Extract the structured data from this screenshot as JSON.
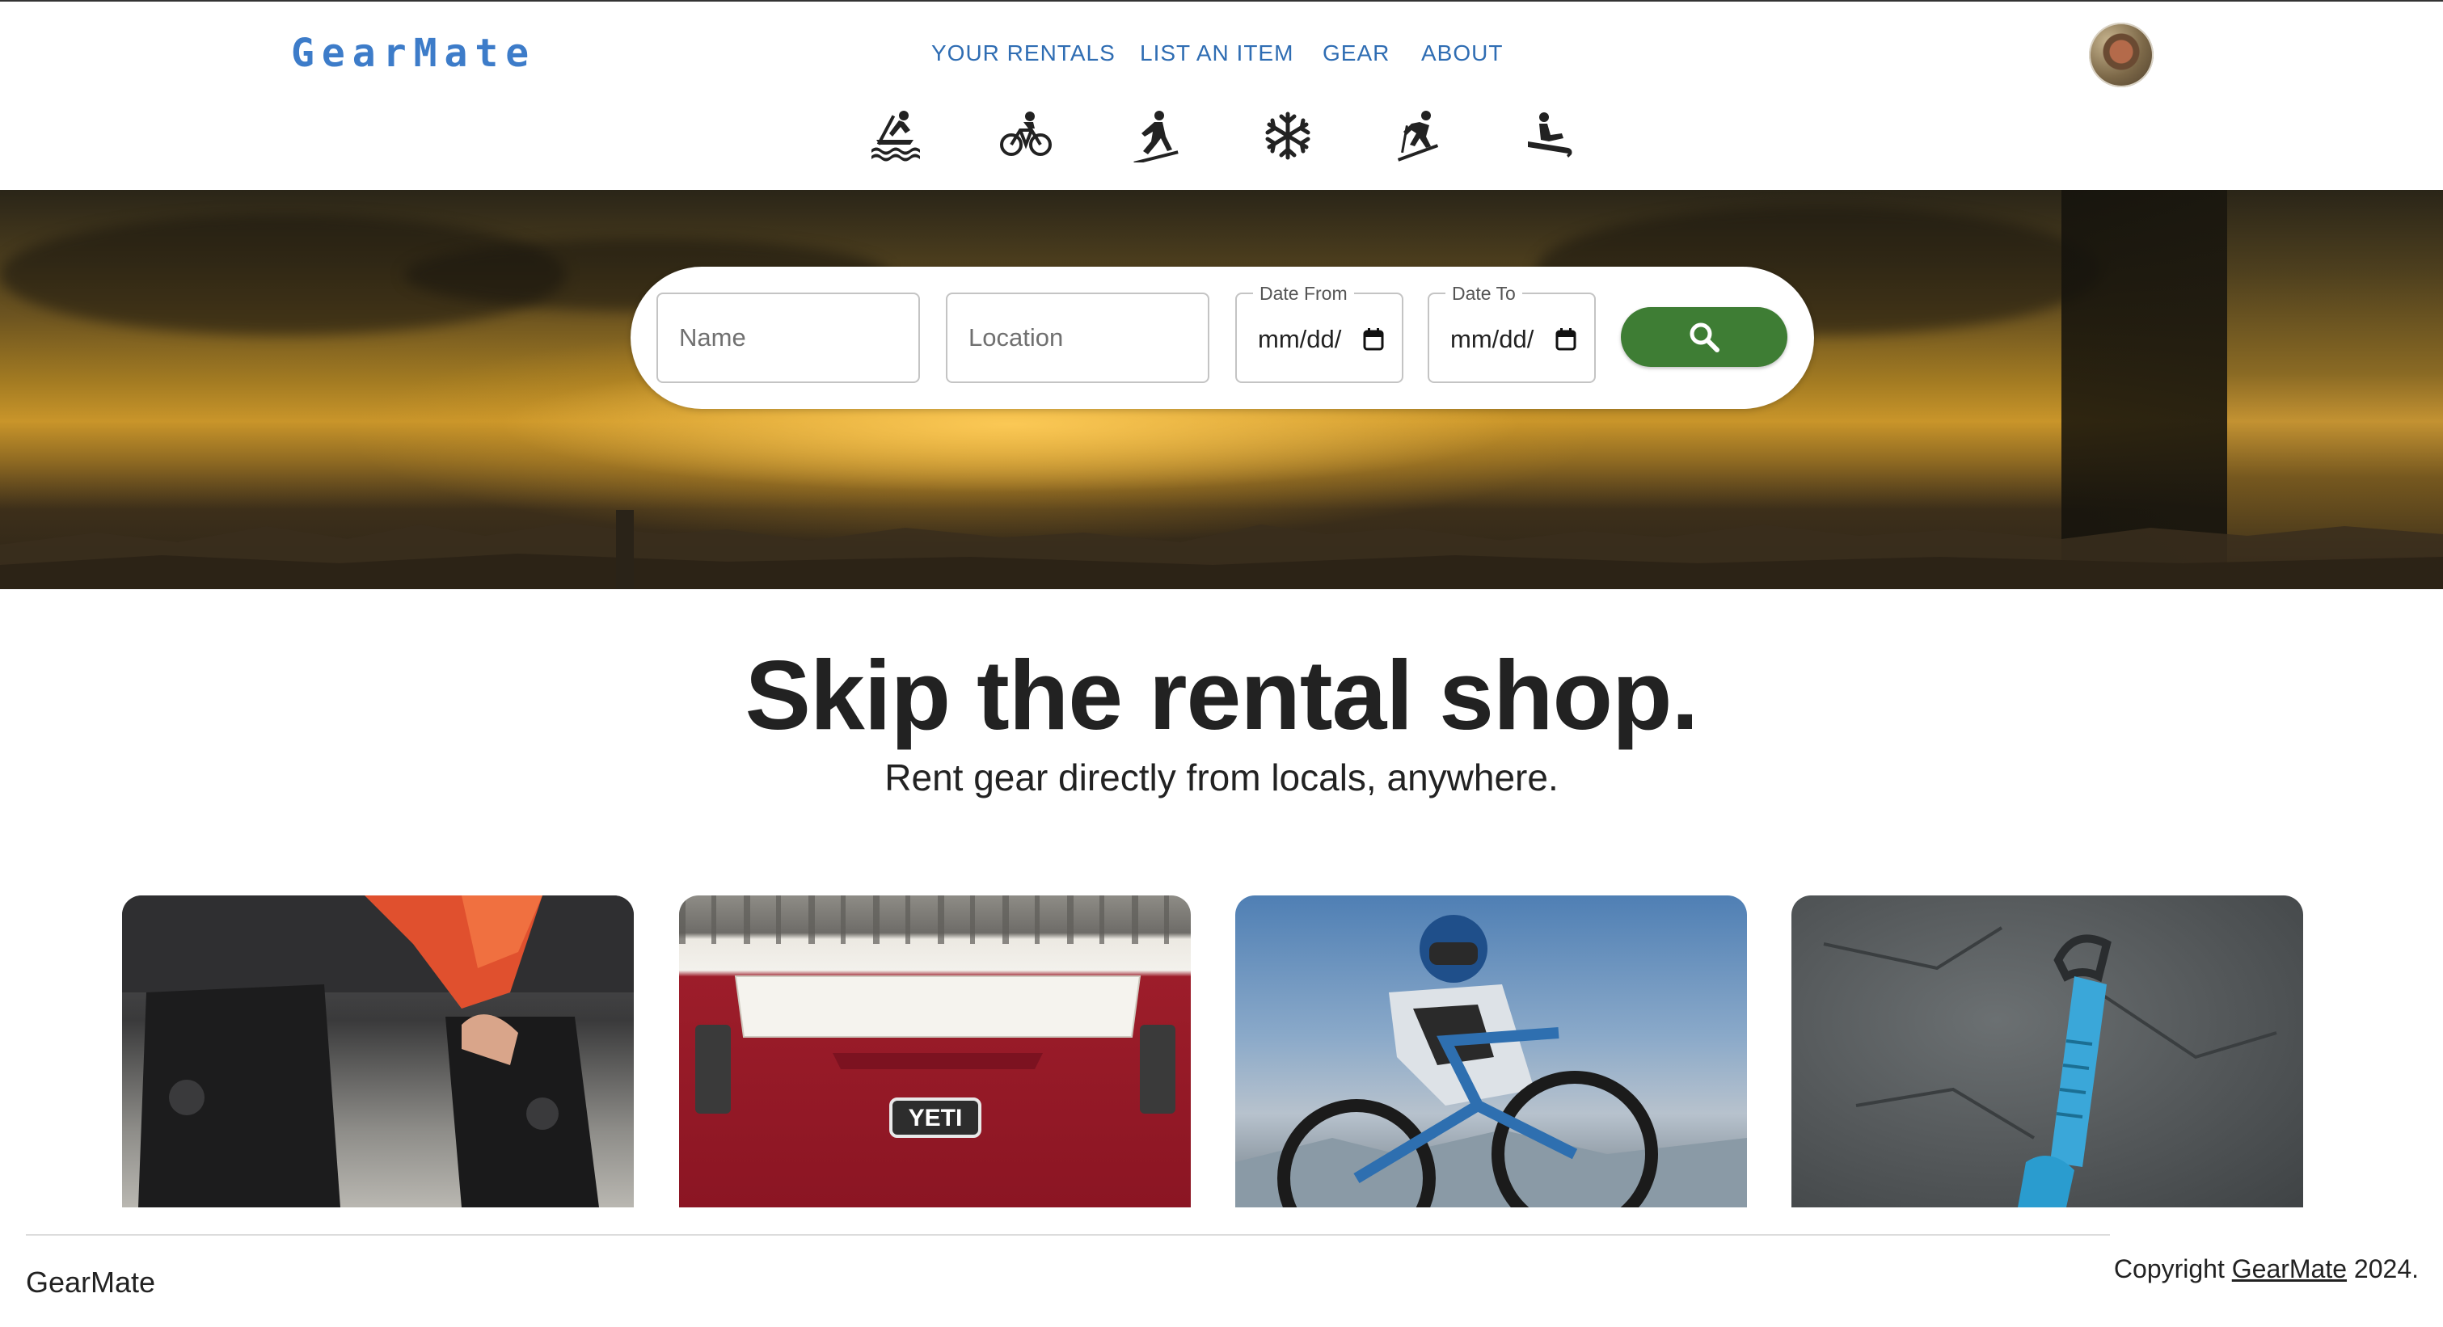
{
  "header": {
    "logo": "GearMate",
    "nav": [
      {
        "label": "YOUR RENTALS"
      },
      {
        "label": "LIST AN ITEM"
      },
      {
        "label": "GEAR"
      },
      {
        "label": "ABOUT"
      }
    ],
    "avatar_icon": "user-avatar",
    "sport_icons": [
      "kayaking-icon",
      "cycling-icon",
      "hiking-icon",
      "snow-icon",
      "skiing-icon",
      "sledding-icon"
    ]
  },
  "search": {
    "name_placeholder": "Name",
    "location_placeholder": "Location",
    "date_from_label": "Date From",
    "date_from_value": "mm/dd/",
    "date_to_label": "Date To",
    "date_to_value": "mm/dd/",
    "button_icon": "search-icon"
  },
  "hero": {
    "headline": "Skip the rental shop.",
    "subheadline": "Rent gear directly from locals, anywhere."
  },
  "cards": [
    {
      "subject": "snowboard-boots"
    },
    {
      "subject": "yeti-cooler",
      "label": "YETI"
    },
    {
      "subject": "mountain-bike"
    },
    {
      "subject": "climbing-quickdraw"
    }
  ],
  "footer": {
    "brand": "GearMate",
    "copyright_prefix": "Copyright ",
    "copyright_link": "GearMate",
    "copyright_suffix": " 2024."
  },
  "colors": {
    "logo": "#3d7cc9",
    "nav": "#2f6db3",
    "search_button": "#3e7d34",
    "text": "#222222"
  }
}
